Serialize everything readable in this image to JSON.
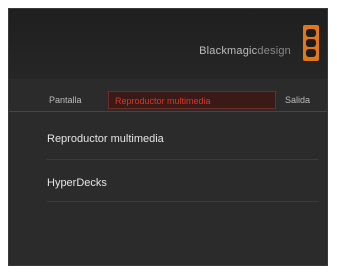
{
  "header": {
    "brand_strong": "Blackmagic",
    "brand_light": "design",
    "logo_icon": "blackmagic-logo-icon",
    "logo_color": "#e0781a"
  },
  "tabs": [
    {
      "label": "Pantalla"
    },
    {
      "label": "Reproductor multimedia"
    },
    {
      "label": "Salida"
    }
  ],
  "active_tab_color": "#d43a2a",
  "menu": {
    "items": [
      {
        "label": "Reproductor multimedia"
      },
      {
        "label": "HyperDecks"
      }
    ]
  }
}
